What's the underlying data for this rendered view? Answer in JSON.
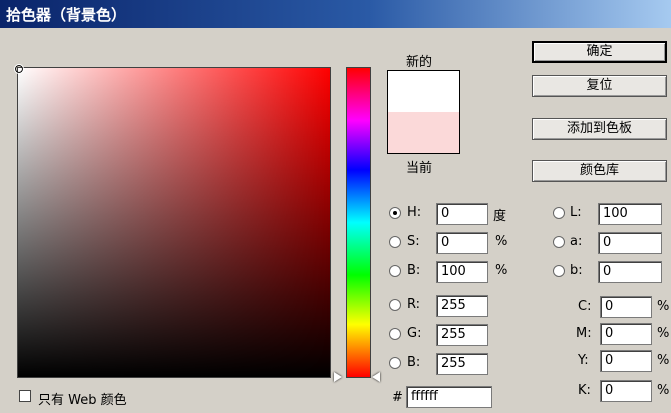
{
  "window": {
    "title": "拾色器（背景色）"
  },
  "preview": {
    "new_label": "新的",
    "current_label": "当前",
    "new_color": "#ffffff",
    "current_color": "#fbd9d9"
  },
  "buttons": {
    "ok": "确定",
    "reset": "复位",
    "add_swatch": "添加到色板",
    "libraries": "颜色库"
  },
  "hsb": {
    "h": {
      "label": "H:",
      "value": "0",
      "unit": "度"
    },
    "s": {
      "label": "S:",
      "value": "0",
      "unit": "%"
    },
    "b": {
      "label": "B:",
      "value": "100",
      "unit": "%"
    }
  },
  "rgb": {
    "r": {
      "label": "R:",
      "value": "255"
    },
    "g": {
      "label": "G:",
      "value": "255"
    },
    "b": {
      "label": "B:",
      "value": "255"
    }
  },
  "lab": {
    "l": {
      "label": "L:",
      "value": "100"
    },
    "a": {
      "label": "a:",
      "value": "0"
    },
    "b": {
      "label": "b:",
      "value": "0"
    }
  },
  "cmyk": {
    "c": {
      "label": "C:",
      "value": "0",
      "unit": "%"
    },
    "m": {
      "label": "M:",
      "value": "0",
      "unit": "%"
    },
    "y": {
      "label": "Y:",
      "value": "0",
      "unit": "%"
    },
    "k": {
      "label": "K:",
      "value": "0",
      "unit": "%"
    }
  },
  "hex": {
    "label": "#",
    "value": "ffffff"
  },
  "web_only": {
    "label": "只有 Web 颜色"
  },
  "field_hue_color": "#ff0000"
}
